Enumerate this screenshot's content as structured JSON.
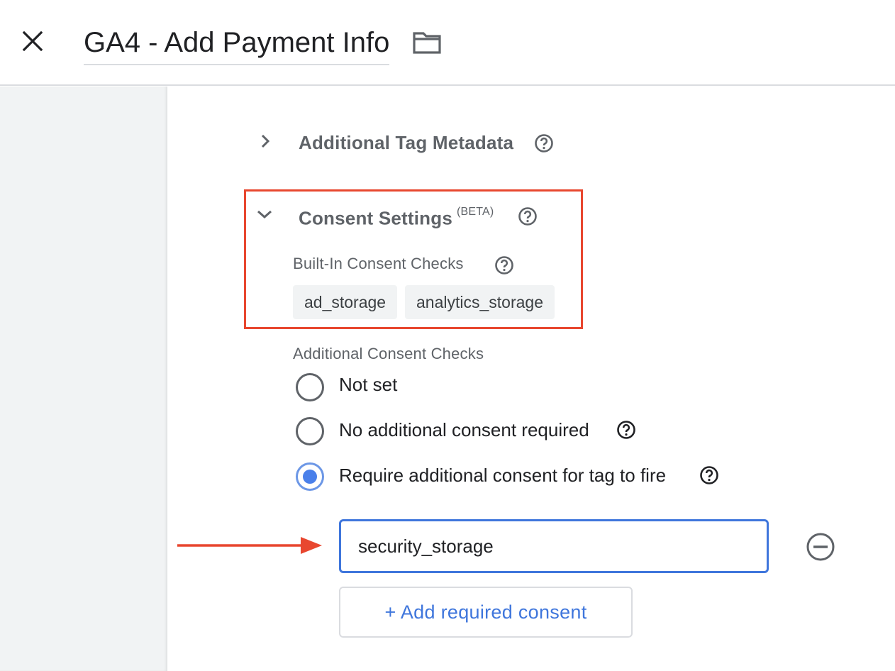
{
  "header": {
    "title": "GA4 - Add Payment Info",
    "close_icon": "close-icon",
    "folder_icon": "folder-icon"
  },
  "sections": {
    "metadata": {
      "title": "Additional Tag Metadata",
      "expanded": false
    },
    "consent": {
      "title": "Consent Settings",
      "badge": "(BETA)",
      "expanded": true,
      "built_in_label": "Built-In Consent Checks",
      "built_in_checks": [
        "ad_storage",
        "analytics_storage"
      ],
      "additional_label": "Additional Consent Checks",
      "options": [
        {
          "label": "Not set",
          "selected": false,
          "help": false
        },
        {
          "label": "No additional consent required",
          "selected": false,
          "help": true
        },
        {
          "label": "Require additional consent for tag to fire",
          "selected": true,
          "help": true
        }
      ],
      "required_consent_value": "security_storage",
      "add_button_label": "+ Add required consent"
    }
  },
  "colors": {
    "accent_blue": "#3f76dc",
    "highlight_red": "#e8472f",
    "muted_text": "#5f6368",
    "chip_bg": "#f1f3f4"
  }
}
